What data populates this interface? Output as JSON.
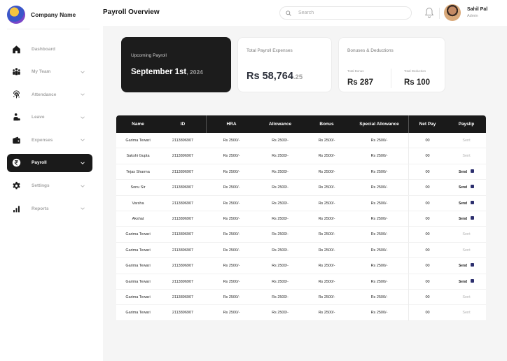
{
  "brand": {
    "name": "Company Name"
  },
  "sidebar": {
    "items": [
      {
        "label": "Dashboard",
        "icon": "home-icon",
        "active": false,
        "has_chevron": false
      },
      {
        "label": "My Team",
        "icon": "team-icon",
        "active": false,
        "has_chevron": true
      },
      {
        "label": "Attendance",
        "icon": "fingerprint-icon",
        "active": false,
        "has_chevron": true
      },
      {
        "label": "Leave",
        "icon": "leave-icon",
        "active": false,
        "has_chevron": true
      },
      {
        "label": "Expenses",
        "icon": "wallet-icon",
        "active": false,
        "has_chevron": true
      },
      {
        "label": "Payroll",
        "icon": "rupee-icon",
        "active": true,
        "has_chevron": true
      },
      {
        "label": "Settings",
        "icon": "gear-icon",
        "active": false,
        "has_chevron": true
      },
      {
        "label": "Reports",
        "icon": "bar-chart-icon",
        "active": false,
        "has_chevron": true
      }
    ]
  },
  "header": {
    "title": "Payroll Overview",
    "search_placeholder": "Search",
    "user_name": "Sahil Pal",
    "user_role": "Admin"
  },
  "cards": {
    "upcoming": {
      "label": "Upcoming Payroll",
      "date": "September 1st",
      "year": ", 2024"
    },
    "total": {
      "label": "Total Payroll Expenses",
      "value": "Rs 58,764",
      "decimal": ".25"
    },
    "bonus": {
      "label": "Bonuses & Deductions",
      "bonus_label": "Total Bonus",
      "bonus_value": "Rs 287",
      "deduction_label": "Total Deduction",
      "deduction_value": "Rs 100"
    }
  },
  "table": {
    "headers": [
      "Name",
      "ID",
      "HRA",
      "Allowance",
      "Bonus",
      "Special Allowance",
      "Net Pay",
      "Payslip"
    ],
    "rows": [
      {
        "name": "Garima Tewari",
        "id": "2113896907",
        "hra": "Rs 2500/-",
        "allowance": "Rs 2500/-",
        "bonus": "Rs 2500/-",
        "special": "Rs 2500/-",
        "net": "00",
        "payslip": "Sent"
      },
      {
        "name": "Sakshi Gupta",
        "id": "2113896907",
        "hra": "Rs 2500/-",
        "allowance": "Rs 2500/-",
        "bonus": "Rs 2500/-",
        "special": "Rs 2500/-",
        "net": "00",
        "payslip": "Sent"
      },
      {
        "name": "Tejas Sharma",
        "id": "2113896907",
        "hra": "Rs 2500/-",
        "allowance": "Rs 2500/-",
        "bonus": "Rs 2500/-",
        "special": "Rs 2500/-",
        "net": "00",
        "payslip": "Send"
      },
      {
        "name": "Sonu Sir",
        "id": "2113896907",
        "hra": "Rs 2500/-",
        "allowance": "Rs 2500/-",
        "bonus": "Rs 2500/-",
        "special": "Rs 2500/-",
        "net": "00",
        "payslip": "Send"
      },
      {
        "name": "Varsha",
        "id": "2113896907",
        "hra": "Rs 2500/-",
        "allowance": "Rs 2500/-",
        "bonus": "Rs 2500/-",
        "special": "Rs 2500/-",
        "net": "00",
        "payslip": "Send"
      },
      {
        "name": "Akshat",
        "id": "2113896907",
        "hra": "Rs 2500/-",
        "allowance": "Rs 2500/-",
        "bonus": "Rs 2500/-",
        "special": "Rs 2500/-",
        "net": "00",
        "payslip": "Send"
      },
      {
        "name": "Garima Tewari",
        "id": "2113896907",
        "hra": "Rs 2500/-",
        "allowance": "Rs 2500/-",
        "bonus": "Rs 2500/-",
        "special": "Rs 2500/-",
        "net": "00",
        "payslip": "Sent"
      },
      {
        "name": "Garima Tewari",
        "id": "2113896907",
        "hra": "Rs 2500/-",
        "allowance": "Rs 2500/-",
        "bonus": "Rs 2500/-",
        "special": "Rs 2500/-",
        "net": "00",
        "payslip": "Sent"
      },
      {
        "name": "Garima Tewari",
        "id": "2113896907",
        "hra": "Rs 2500/-",
        "allowance": "Rs 2500/-",
        "bonus": "Rs 2500/-",
        "special": "Rs 2500/-",
        "net": "00",
        "payslip": "Send"
      },
      {
        "name": "Garima Tewari",
        "id": "2113896907",
        "hra": "Rs 2500/-",
        "allowance": "Rs 2500/-",
        "bonus": "Rs 2500/-",
        "special": "Rs 2500/-",
        "net": "00",
        "payslip": "Send"
      },
      {
        "name": "Garima Tewari",
        "id": "2113896907",
        "hra": "Rs 2500/-",
        "allowance": "Rs 2500/-",
        "bonus": "Rs 2500/-",
        "special": "Rs 2500/-",
        "net": "00",
        "payslip": "Sent"
      },
      {
        "name": "Garima Tewari",
        "id": "2113896907",
        "hra": "Rs 2500/-",
        "allowance": "Rs 2500/-",
        "bonus": "Rs 2500/-",
        "special": "Rs 2500/-",
        "net": "00",
        "payslip": "Sent"
      }
    ]
  },
  "colors": {
    "dark": "#1a1a1a",
    "muted": "#a6a6a6",
    "background": "#f5f5f5",
    "lock": "#2c2f6e"
  }
}
